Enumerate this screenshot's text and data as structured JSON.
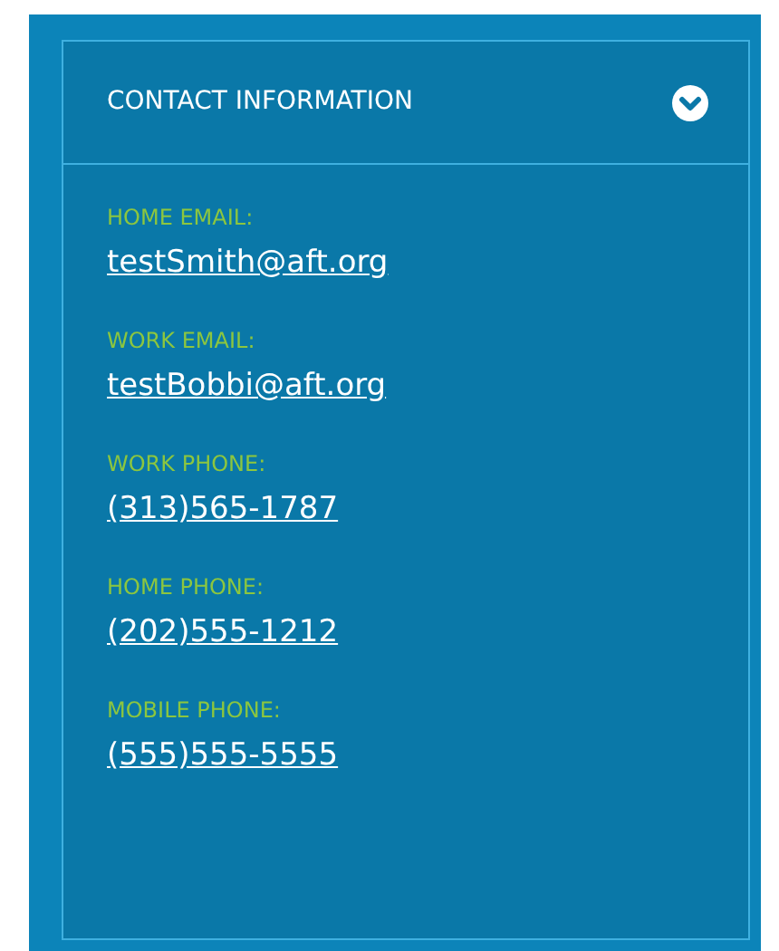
{
  "panel": {
    "title": "CONTACT INFORMATION",
    "expanded": true,
    "fields": [
      {
        "label": "HOME EMAIL:",
        "value": "testSmith@aft.org"
      },
      {
        "label": "WORK EMAIL:",
        "value": "testBobbi@aft.org"
      },
      {
        "label": "WORK PHONE:",
        "value": "(313)565-1787"
      },
      {
        "label": "HOME PHONE:",
        "value": "(202)555-1212"
      },
      {
        "label": "MOBILE PHONE:",
        "value": "(555)555-5555"
      }
    ]
  }
}
